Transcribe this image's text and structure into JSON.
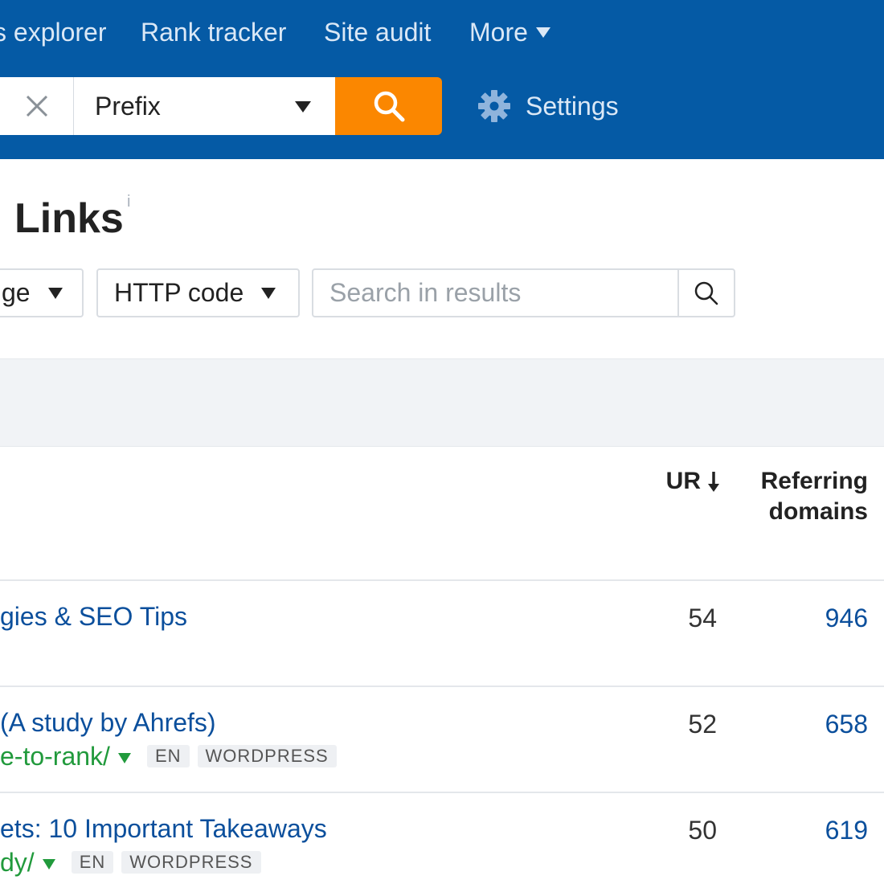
{
  "nav": {
    "items": [
      {
        "label": "s explorer"
      },
      {
        "label": "Rank tracker"
      },
      {
        "label": "Site audit"
      },
      {
        "label": "More"
      }
    ]
  },
  "search": {
    "mode_value": "Prefix",
    "settings_label": "Settings"
  },
  "page": {
    "title": "Links",
    "info_mark": "i"
  },
  "filters": {
    "language_label": "ge",
    "http_label": "HTTP code",
    "search_placeholder": "Search in results"
  },
  "table": {
    "col_ur": "UR",
    "col_rd_line1": "Referring",
    "col_rd_line2": "domains",
    "rows": [
      {
        "title": "gies & SEO Tips",
        "url": "",
        "tags": [],
        "ur": "54",
        "rd": "946"
      },
      {
        "title": "(A study by Ahrefs)",
        "url": "e-to-rank/",
        "tags": [
          "EN",
          "WORDPRESS"
        ],
        "ur": "52",
        "rd": "658"
      },
      {
        "title": "ets: 10 Important Takeaways",
        "url": "dy/",
        "tags": [
          "EN",
          "WORDPRESS"
        ],
        "ur": "50",
        "rd": "619"
      }
    ]
  },
  "colors": {
    "header_bg": "#055aa5",
    "search_button": "#fb8700",
    "link_blue": "#0b4f9c",
    "url_green": "#219a3c"
  }
}
